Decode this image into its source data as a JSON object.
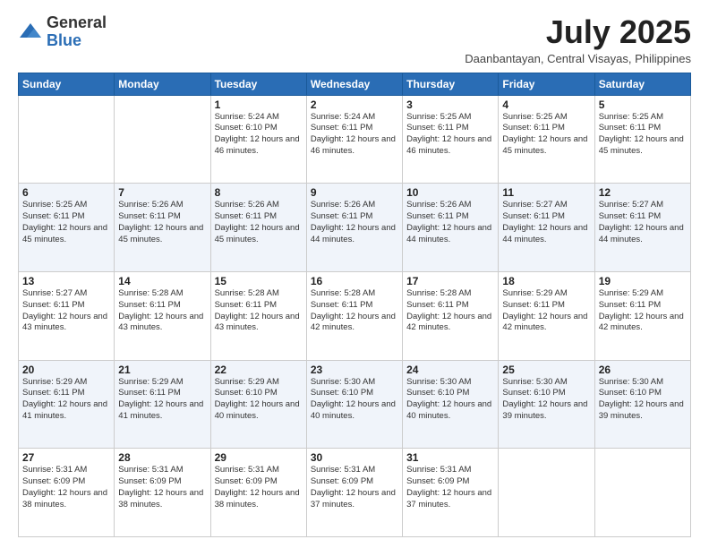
{
  "logo": {
    "general": "General",
    "blue": "Blue"
  },
  "title": {
    "month_year": "July 2025",
    "location": "Daanbantayan, Central Visayas, Philippines"
  },
  "weekdays": [
    "Sunday",
    "Monday",
    "Tuesday",
    "Wednesday",
    "Thursday",
    "Friday",
    "Saturday"
  ],
  "weeks": [
    [
      {
        "day": "",
        "info": ""
      },
      {
        "day": "",
        "info": ""
      },
      {
        "day": "1",
        "info": "Sunrise: 5:24 AM\nSunset: 6:10 PM\nDaylight: 12 hours and 46 minutes."
      },
      {
        "day": "2",
        "info": "Sunrise: 5:24 AM\nSunset: 6:11 PM\nDaylight: 12 hours and 46 minutes."
      },
      {
        "day": "3",
        "info": "Sunrise: 5:25 AM\nSunset: 6:11 PM\nDaylight: 12 hours and 46 minutes."
      },
      {
        "day": "4",
        "info": "Sunrise: 5:25 AM\nSunset: 6:11 PM\nDaylight: 12 hours and 45 minutes."
      },
      {
        "day": "5",
        "info": "Sunrise: 5:25 AM\nSunset: 6:11 PM\nDaylight: 12 hours and 45 minutes."
      }
    ],
    [
      {
        "day": "6",
        "info": "Sunrise: 5:25 AM\nSunset: 6:11 PM\nDaylight: 12 hours and 45 minutes."
      },
      {
        "day": "7",
        "info": "Sunrise: 5:26 AM\nSunset: 6:11 PM\nDaylight: 12 hours and 45 minutes."
      },
      {
        "day": "8",
        "info": "Sunrise: 5:26 AM\nSunset: 6:11 PM\nDaylight: 12 hours and 45 minutes."
      },
      {
        "day": "9",
        "info": "Sunrise: 5:26 AM\nSunset: 6:11 PM\nDaylight: 12 hours and 44 minutes."
      },
      {
        "day": "10",
        "info": "Sunrise: 5:26 AM\nSunset: 6:11 PM\nDaylight: 12 hours and 44 minutes."
      },
      {
        "day": "11",
        "info": "Sunrise: 5:27 AM\nSunset: 6:11 PM\nDaylight: 12 hours and 44 minutes."
      },
      {
        "day": "12",
        "info": "Sunrise: 5:27 AM\nSunset: 6:11 PM\nDaylight: 12 hours and 44 minutes."
      }
    ],
    [
      {
        "day": "13",
        "info": "Sunrise: 5:27 AM\nSunset: 6:11 PM\nDaylight: 12 hours and 43 minutes."
      },
      {
        "day": "14",
        "info": "Sunrise: 5:28 AM\nSunset: 6:11 PM\nDaylight: 12 hours and 43 minutes."
      },
      {
        "day": "15",
        "info": "Sunrise: 5:28 AM\nSunset: 6:11 PM\nDaylight: 12 hours and 43 minutes."
      },
      {
        "day": "16",
        "info": "Sunrise: 5:28 AM\nSunset: 6:11 PM\nDaylight: 12 hours and 42 minutes."
      },
      {
        "day": "17",
        "info": "Sunrise: 5:28 AM\nSunset: 6:11 PM\nDaylight: 12 hours and 42 minutes."
      },
      {
        "day": "18",
        "info": "Sunrise: 5:29 AM\nSunset: 6:11 PM\nDaylight: 12 hours and 42 minutes."
      },
      {
        "day": "19",
        "info": "Sunrise: 5:29 AM\nSunset: 6:11 PM\nDaylight: 12 hours and 42 minutes."
      }
    ],
    [
      {
        "day": "20",
        "info": "Sunrise: 5:29 AM\nSunset: 6:11 PM\nDaylight: 12 hours and 41 minutes."
      },
      {
        "day": "21",
        "info": "Sunrise: 5:29 AM\nSunset: 6:11 PM\nDaylight: 12 hours and 41 minutes."
      },
      {
        "day": "22",
        "info": "Sunrise: 5:29 AM\nSunset: 6:10 PM\nDaylight: 12 hours and 40 minutes."
      },
      {
        "day": "23",
        "info": "Sunrise: 5:30 AM\nSunset: 6:10 PM\nDaylight: 12 hours and 40 minutes."
      },
      {
        "day": "24",
        "info": "Sunrise: 5:30 AM\nSunset: 6:10 PM\nDaylight: 12 hours and 40 minutes."
      },
      {
        "day": "25",
        "info": "Sunrise: 5:30 AM\nSunset: 6:10 PM\nDaylight: 12 hours and 39 minutes."
      },
      {
        "day": "26",
        "info": "Sunrise: 5:30 AM\nSunset: 6:10 PM\nDaylight: 12 hours and 39 minutes."
      }
    ],
    [
      {
        "day": "27",
        "info": "Sunrise: 5:31 AM\nSunset: 6:09 PM\nDaylight: 12 hours and 38 minutes."
      },
      {
        "day": "28",
        "info": "Sunrise: 5:31 AM\nSunset: 6:09 PM\nDaylight: 12 hours and 38 minutes."
      },
      {
        "day": "29",
        "info": "Sunrise: 5:31 AM\nSunset: 6:09 PM\nDaylight: 12 hours and 38 minutes."
      },
      {
        "day": "30",
        "info": "Sunrise: 5:31 AM\nSunset: 6:09 PM\nDaylight: 12 hours and 37 minutes."
      },
      {
        "day": "31",
        "info": "Sunrise: 5:31 AM\nSunset: 6:09 PM\nDaylight: 12 hours and 37 minutes."
      },
      {
        "day": "",
        "info": ""
      },
      {
        "day": "",
        "info": ""
      }
    ]
  ]
}
